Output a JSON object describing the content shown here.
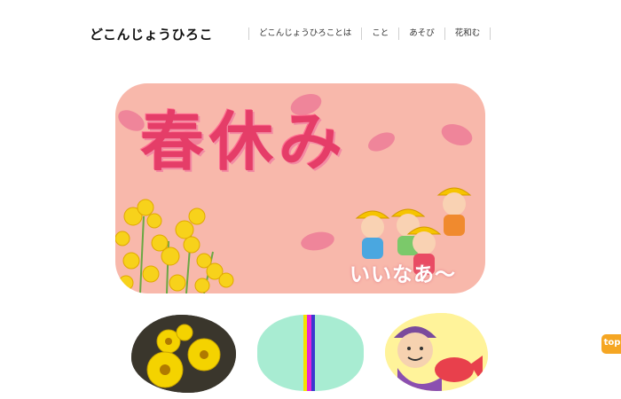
{
  "header": {
    "site_title": "どこんじょうひろこ",
    "nav": [
      "どこんじょうひろことは",
      "こと",
      "あそび",
      "花和む"
    ]
  },
  "hero": {
    "title": "春休み",
    "caption": "いいなあ〜"
  },
  "thumbnails": [
    {
      "icon": "yellow-flowers-photo"
    },
    {
      "icon": "striped-pattern"
    },
    {
      "icon": "ebisu-illustration"
    }
  ],
  "top_button": "top",
  "colors": {
    "hero_bg": "#f8b8ab",
    "hero_title": "#e53d68",
    "top_button": "#f5a623"
  }
}
